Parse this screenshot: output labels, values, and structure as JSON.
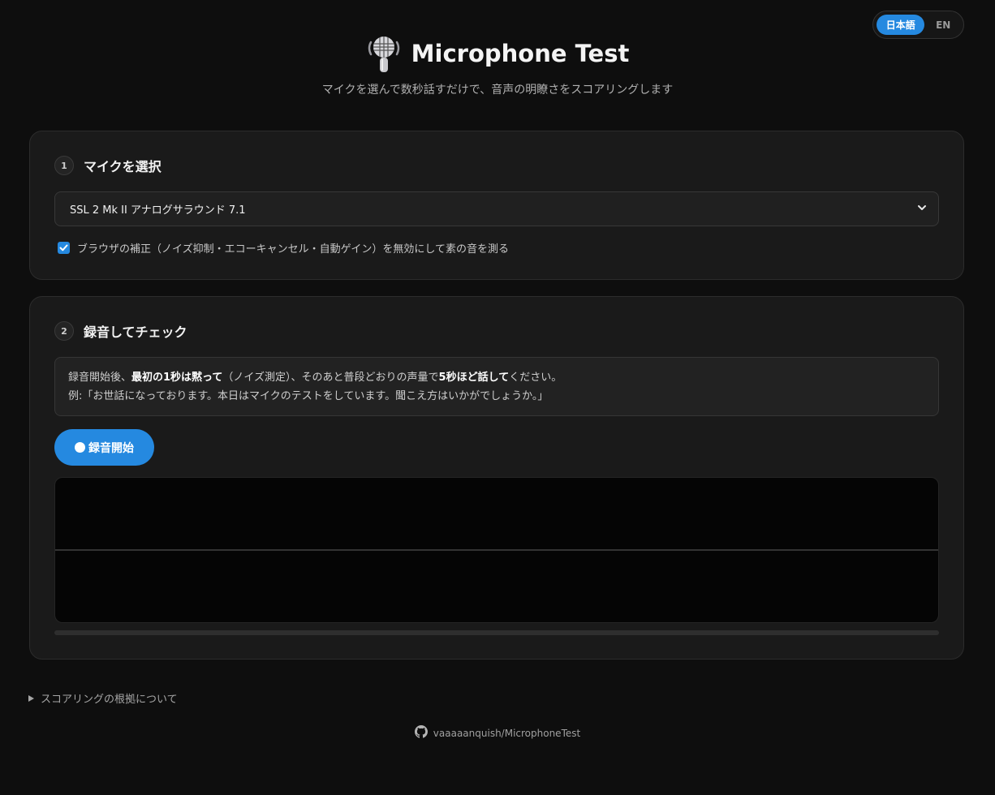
{
  "lang": {
    "ja": "日本語",
    "en": "EN",
    "active": "ja"
  },
  "header": {
    "title": "Microphone Test",
    "subtitle": "マイクを選んで数秒話すだけで、音声の明瞭さをスコアリングします",
    "icon": "microphone-icon"
  },
  "step1": {
    "number": "1",
    "title": "マイクを選択",
    "selected_mic": "SSL 2 Mk II アナログサラウンド 7.1",
    "checkbox_checked": true,
    "checkbox_label": "ブラウザの補正（ノイズ抑制・エコーキャンセル・自動ゲイン）を無効にして素の音を測る"
  },
  "step2": {
    "number": "2",
    "title": "録音してチェック",
    "instr_pre": "録音開始後、",
    "instr_b1": "最初の1秒は黙って",
    "instr_mid": "（ノイズ測定）、そのあと普段どおりの声量で",
    "instr_b2": "5秒ほど話して",
    "instr_post": "ください。",
    "example": "例:「お世話になっております。本日はマイクのテストをしています。聞こえ方はいかがでしょうか。」",
    "record_label": "録音開始",
    "record_icon": "record-dot-icon"
  },
  "waveform": {
    "gradient_colors": [
      "#2fd8b0",
      "#2a8de0",
      "#4030d0",
      "#e030c8"
    ]
  },
  "footer": {
    "details_label": "スコアリングの根拠について",
    "repo": "vaaaaanquish/MicrophoneTest",
    "repo_icon": "github-icon"
  }
}
